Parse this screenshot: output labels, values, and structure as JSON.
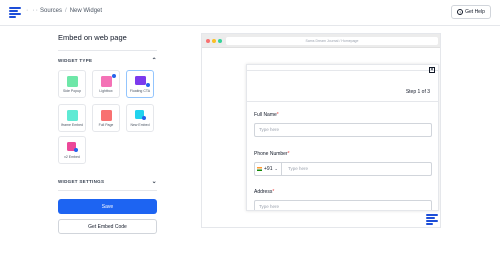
{
  "header": {
    "dots": "· ·· ·",
    "breadcrumb": [
      "Sources",
      "New Widget"
    ],
    "breadcrumb_sep": "/",
    "help_label": "Get Help"
  },
  "panel": {
    "title": "Embed on web page",
    "widget_type_label": "WIDGET TYPE",
    "widget_settings_label": "WIDGET SETTINGS",
    "widget_types": [
      {
        "label": "Side Popup",
        "icon": "side-popup-icon",
        "color": "#6ee7a8"
      },
      {
        "label": "Lightbox",
        "icon": "lightbox-icon",
        "color": "#f472b6"
      },
      {
        "label": "Floating CTA",
        "icon": "floating-cta-icon",
        "color": "#7c3aed"
      },
      {
        "label": "Iframe Embed",
        "icon": "iframe-embed-icon",
        "color": "#5eead4"
      },
      {
        "label": "Full Page",
        "icon": "full-page-icon",
        "color": "#f87171"
      },
      {
        "label": "New Embed",
        "icon": "new-embed-icon",
        "color": "#22d3ee"
      },
      {
        "label": "v2 Embed",
        "icon": "v2-embed-icon",
        "color": "#ec4899"
      }
    ],
    "save_label": "Save",
    "get_code_label": "Get Embed Code"
  },
  "preview": {
    "url": "Sams Dream Journal / Homepage",
    "step": "Step 1 of 3",
    "close": "×",
    "fields": [
      {
        "label": "Full Name",
        "placeholder": "Type here"
      },
      {
        "label": "Phone Number",
        "placeholder": "Type here",
        "country_code": "+91"
      },
      {
        "label": "Address",
        "placeholder": "Type here"
      }
    ],
    "required_mark": "*"
  },
  "colors": {
    "accent": "#1d64f2",
    "brand": "#1d4ed8"
  }
}
